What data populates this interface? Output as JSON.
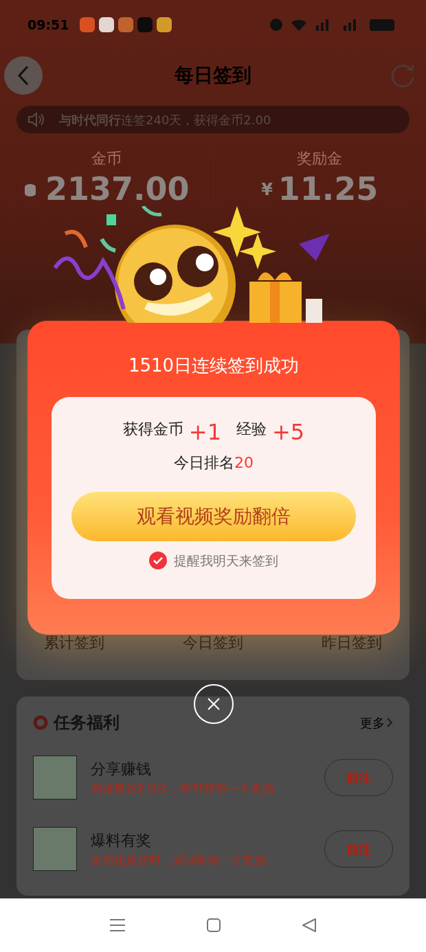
{
  "status_bar": {
    "time": "09:51"
  },
  "header": {
    "title": "每日签到"
  },
  "notice": "**与时代同行**连签240天，获得金币2.00",
  "balances": [
    {
      "kind": "coins",
      "label": "金币",
      "value": "2137.00"
    },
    {
      "kind": "cash",
      "label": "奖励金",
      "prefix": "¥",
      "value": "11.25"
    }
  ],
  "stats": [
    "累计签到",
    "今日签到",
    "昨日签到"
  ],
  "tasks": {
    "title": "任务福利",
    "more": "更多",
    "items": [
      {
        "title": "分享赚钱",
        "desc": "阅读量达到3次，即可获得一个奖励",
        "action": "前往"
      },
      {
        "title": "爆料有奖",
        "desc": "发布优质好料，采纳即得一个奖励",
        "action": "前往"
      }
    ]
  },
  "dialog": {
    "title": "1510日连续签到成功",
    "rewards": [
      {
        "label": "获得金币",
        "amount": "+1"
      },
      {
        "label": "经验",
        "amount": "+5"
      }
    ],
    "rank_label": "今日排名",
    "rank": "20",
    "button": "观看视频奖励翻倍",
    "reminder": {
      "label": "提醒我明天来签到",
      "checked": true
    }
  }
}
